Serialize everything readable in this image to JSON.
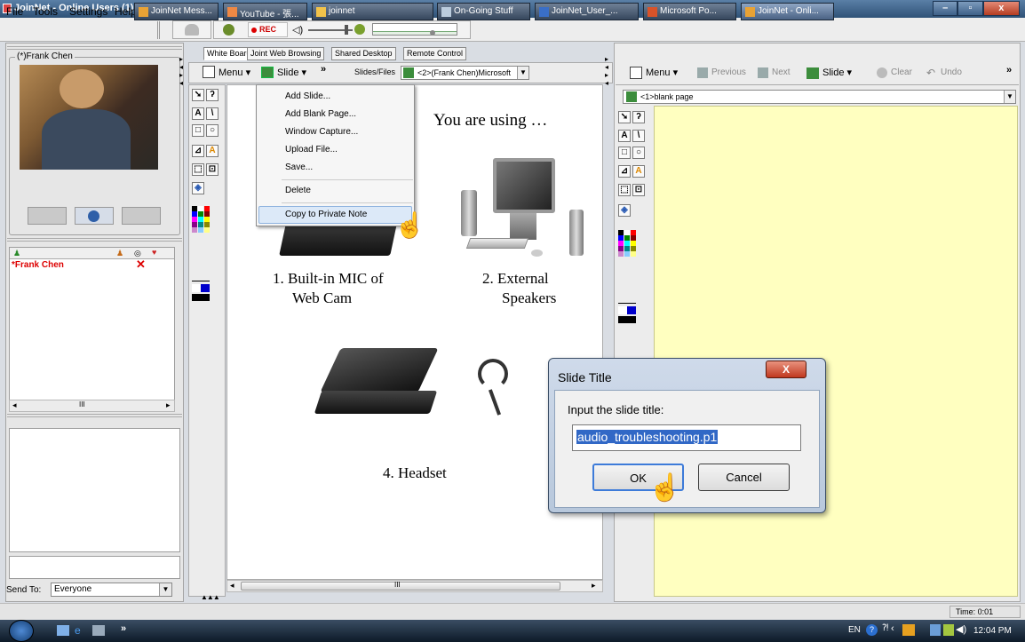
{
  "window": {
    "title": "JoinNet - Online Users (1)"
  },
  "menubar": {
    "file": "File",
    "tools": "Tools",
    "settings": "Settings",
    "help": "Help",
    "rec": "REC"
  },
  "tabs": [
    "White Board",
    "Joint Web Browsing",
    "Shared Desktop",
    "Remote Control"
  ],
  "left": {
    "video_label": "(*)Frank Chen",
    "user_name": "*Frank Chen",
    "scroll_mark": "III",
    "send_to_label": "Send To:",
    "send_to_value": "Everyone"
  },
  "toolbar_left": {
    "menu": "Menu",
    "slide": "Slide",
    "more": "»",
    "slides_files": "Slides/Files",
    "current": "<2>(Frank Chen)Microsoft"
  },
  "toolbar_right": {
    "menu": "Menu",
    "previous": "Previous",
    "next": "Next",
    "slide": "Slide",
    "clear": "Clear",
    "undo": "Undo",
    "more": "»",
    "page": "<1>blank page"
  },
  "slide_menu": [
    "Add Slide...",
    "Add Blank Page...",
    "Window Capture...",
    "Upload File...",
    "Save...",
    "Delete",
    "Copy to Private Note"
  ],
  "slide": {
    "heading": "You are using …",
    "item1_line1": "1. Built-in MIC of",
    "item1_line2": "Web Cam",
    "item2_line1": "2. External",
    "item2_line2": "Speakers",
    "item4": "4. Headset",
    "scroll_mark": "III"
  },
  "dialog": {
    "title": "Slide Title",
    "close": "X",
    "label": "Input the slide title:",
    "value": "audio_troubleshooting.p1",
    "ok": "OK",
    "cancel": "Cancel"
  },
  "status": {
    "time": "Time: 0:01"
  },
  "taskbar": {
    "more": "»",
    "tasks": [
      "JoinNet Mess...",
      "YouTube - 張...",
      "joinnet",
      "On-Going Stuff",
      "JoinNet_User_...",
      "Microsoft Po...",
      "JoinNet - Onli..."
    ],
    "lang": "EN",
    "clock": "12:04 PM"
  },
  "colors": {
    "whiteboard_bg": "#ffffc0",
    "selection": "#3168c6",
    "title_gradient_top": "#5a7fa6"
  }
}
